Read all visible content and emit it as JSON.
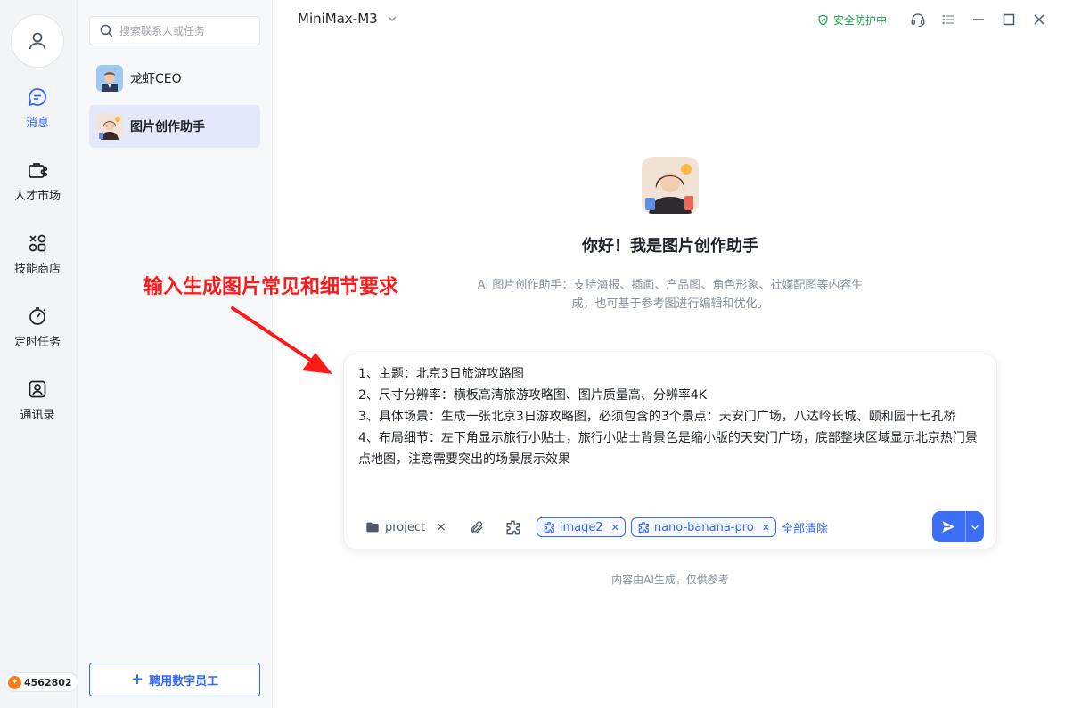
{
  "rail": {
    "items": [
      {
        "label": "消息",
        "icon": "message-icon",
        "active": true
      },
      {
        "label": "人才市场",
        "icon": "briefcase-share-icon"
      },
      {
        "label": "技能商店",
        "icon": "apps-icon"
      },
      {
        "label": "定时任务",
        "icon": "stopwatch-icon"
      },
      {
        "label": "通讯录",
        "icon": "contact-card-icon"
      }
    ],
    "points": "4562802"
  },
  "contacts": {
    "search_placeholder": "搜索联系人或任务",
    "items": [
      {
        "name": "龙虾CEO"
      },
      {
        "name": "图片创作助手",
        "active": true
      }
    ],
    "hire_label": "聘用数字员工"
  },
  "header": {
    "model": "MiniMax-M3",
    "security": "安全防护中"
  },
  "welcome": {
    "greeting": "你好！我是图片创作助手",
    "description": "AI 图片创作助手：支持海报、插画、产品图、角色形象、社媒配图等内容生成，也可基于参考图进行编辑和优化。"
  },
  "annotation": "输入生成图片常见和细节要求",
  "composer": {
    "lines": [
      "1、主题：北京3日旅游攻路图",
      "2、尺寸分辨率：横板高清旅游攻略图、图片质量高、分辨率4K",
      "3、具体场景：生成一张北京3日游攻略图，必须包含的3个景点：天安门广场，八达岭长城、颐和园十七孔桥",
      "4、布局细节：左下角显示旅行小贴士，旅行小贴士背景色是缩小版的天安门广场，底部整块区域显示北京热门景点地图，注意需要突出的场景展示效果"
    ],
    "project_label": "project",
    "chips": [
      "image2",
      "nano-banana-pro"
    ],
    "clear_all": "全部清除"
  },
  "disclaimer": "内容由AI生成，仅供参考",
  "colors": {
    "accent": "#3366ff",
    "annotation": "#ff1a1a",
    "security": "#16a34a"
  }
}
